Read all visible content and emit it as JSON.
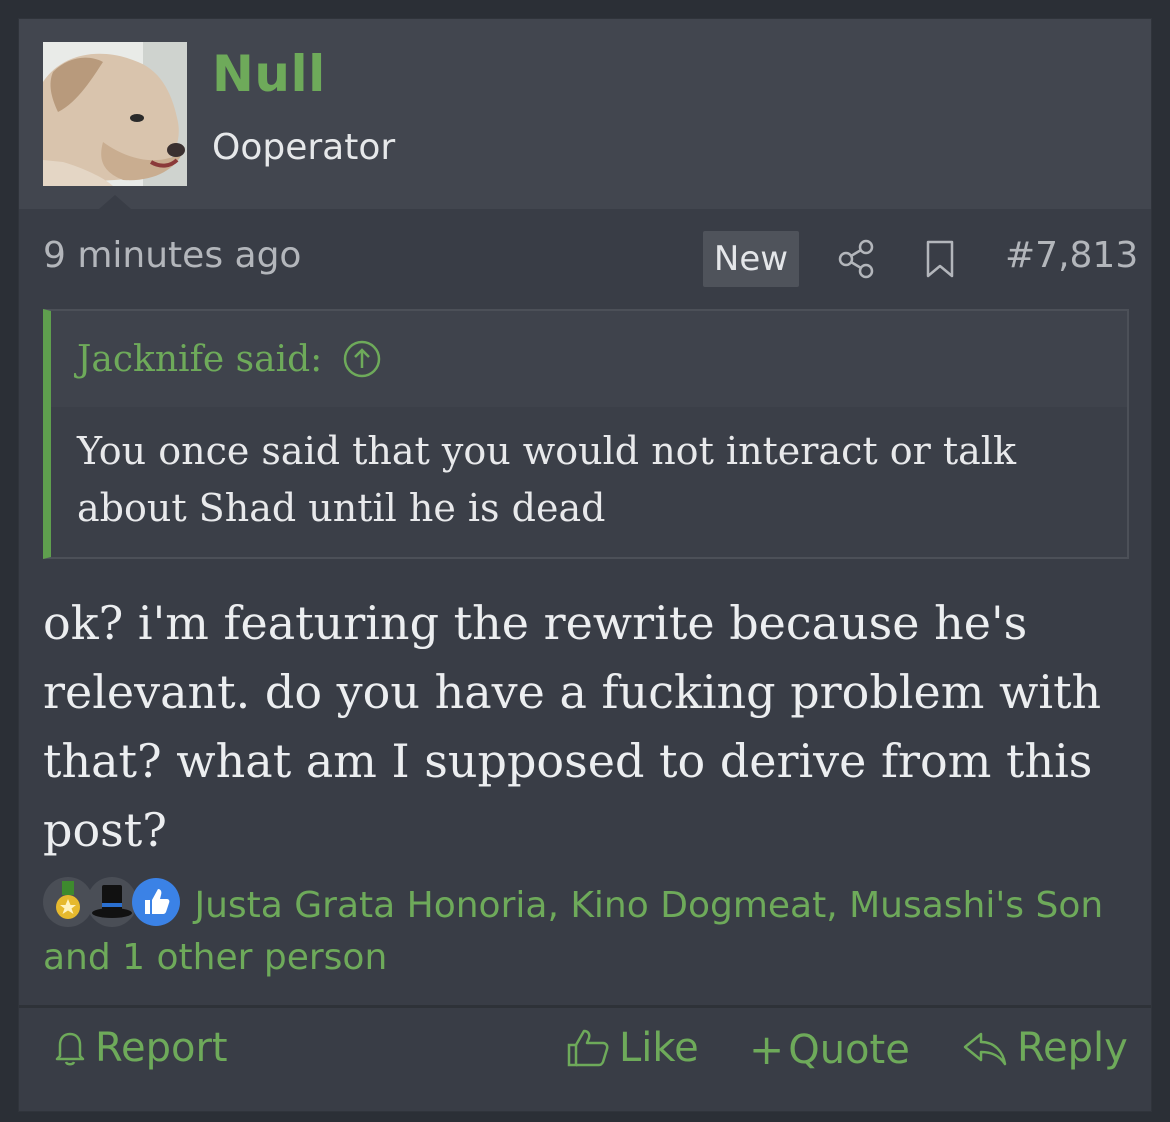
{
  "post": {
    "author": {
      "name": "Null",
      "title": "Ooperator"
    },
    "meta": {
      "time": "9 minutes ago",
      "new_badge": "New",
      "post_number": "#7,813"
    },
    "quote": {
      "attribution": "Jacknife said:",
      "text": "You once said that you would not interact or talk about Shad until he is dead"
    },
    "message": "ok? i'm featuring the rewrite because he's relevant. do you have a fucking problem with that? what am I supposed to derive from this post?",
    "reactions": {
      "icons": [
        "medal-icon",
        "top-hat-icon",
        "thumbs-up-icon"
      ],
      "text": "Justa Grata Honoria, Kino Dogmeat, Musashi's Son and 1 other person"
    },
    "actions": {
      "report": "Report",
      "like": "Like",
      "quote": "Quote",
      "reply": "Reply"
    }
  },
  "colors": {
    "accent": "#6eaa5a",
    "background": "#393d46",
    "header": "#42464f"
  }
}
